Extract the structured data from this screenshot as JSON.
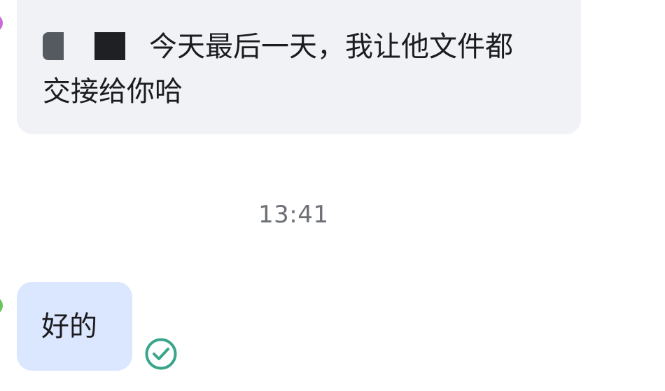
{
  "messages": {
    "incoming": {
      "line1_text": "今天最后一天，我让他文件都",
      "line2_text": "交接给你哈"
    },
    "timestamp": "13:41",
    "outgoing": {
      "text": "好的",
      "status_icon": "check-circle-icon"
    }
  },
  "colors": {
    "incoming_bubble": "#f1f2f5",
    "outgoing_bubble": "#dbe6ff",
    "read_check": "#3aa58a",
    "timestamp": "#6c6f74"
  }
}
